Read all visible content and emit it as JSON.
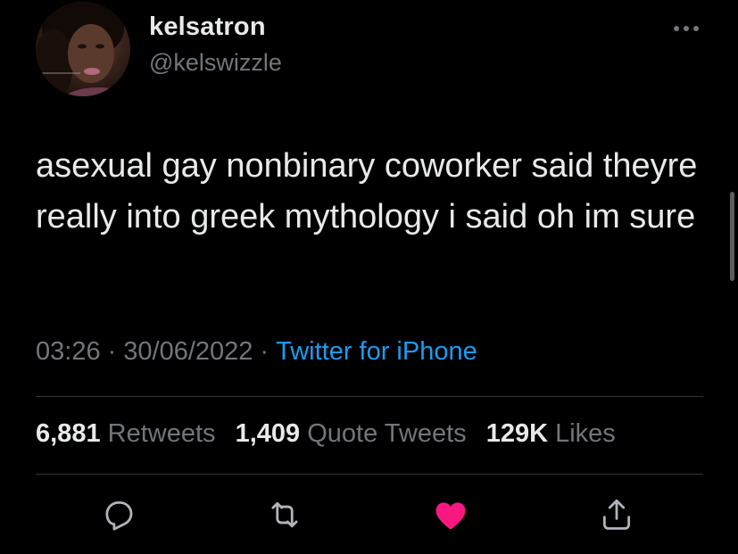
{
  "tweet": {
    "display_name": "kelsatron",
    "handle": "@kelswizzle",
    "text": "asexual gay nonbinary coworker said theyre really into greek mythology i said oh im sure",
    "time": "03:26",
    "date": "30/06/2022",
    "separator": "·",
    "source": "Twitter for iPhone"
  },
  "stats": {
    "retweets_count": "6,881",
    "retweets_label": "Retweets",
    "quotes_count": "1,409",
    "quotes_label": "Quote Tweets",
    "likes_count": "129K",
    "likes_label": "Likes"
  },
  "icons": {
    "more": "more-horizontal-icon",
    "reply": "reply-icon",
    "retweet": "retweet-icon",
    "like": "heart-icon",
    "share": "share-icon"
  },
  "colors": {
    "background": "#000000",
    "text_primary": "#e7e9ea",
    "text_secondary": "#71767b",
    "link": "#1d9bf0",
    "like_active": "#f91880",
    "divider": "#2f3336"
  },
  "state": {
    "liked": true
  }
}
